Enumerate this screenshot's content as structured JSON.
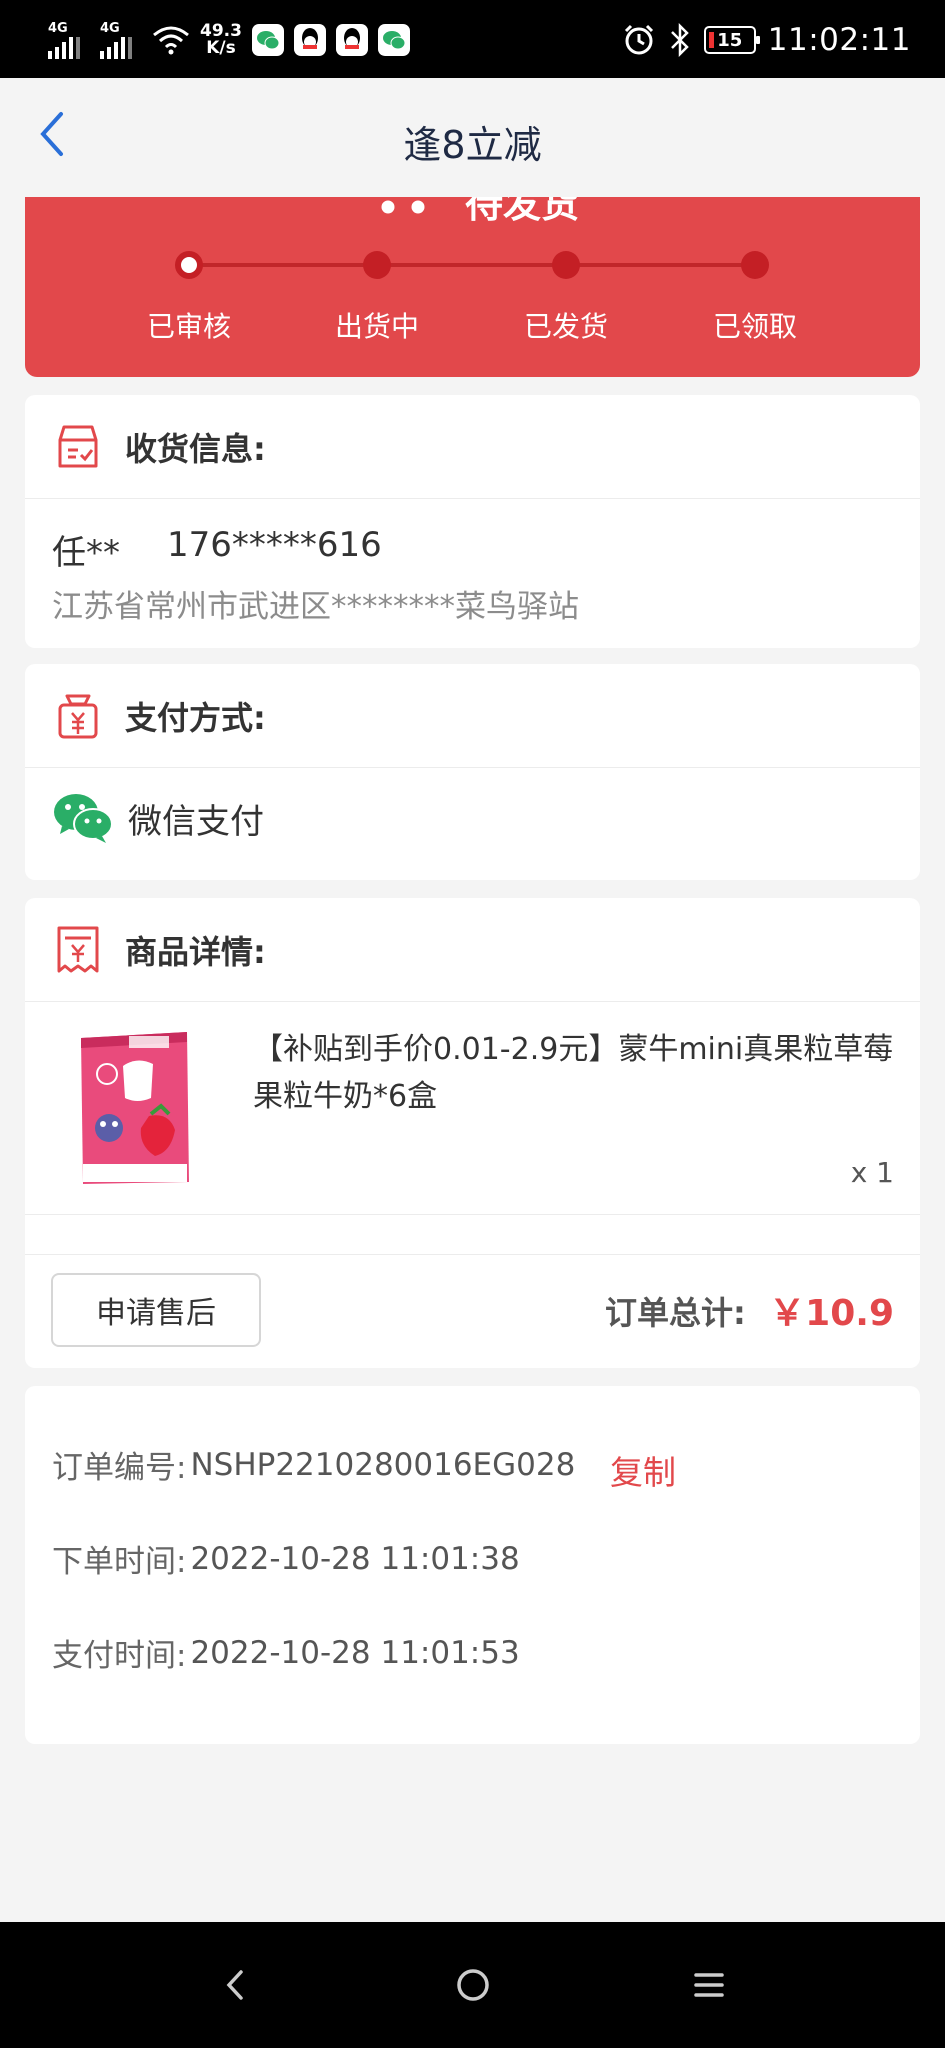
{
  "status_bar": {
    "signal1_label": "4G",
    "signal2_label": "4G",
    "net_speed_value": "49.3",
    "net_speed_unit": "K/s",
    "battery": "15",
    "time": "11:02:11"
  },
  "nav": {
    "title": "逢8立减",
    "back_icon": "chevron-left-icon"
  },
  "progress": {
    "status_text": "待发货",
    "steps": [
      {
        "label": "已审核",
        "active": true
      },
      {
        "label": "出货中",
        "active": false
      },
      {
        "label": "已发货",
        "active": false
      },
      {
        "label": "已领取",
        "active": false
      }
    ]
  },
  "shipping": {
    "title": "收货信息:",
    "name": "任**",
    "phone": "176*****616",
    "address": "江苏省常州市武进区********菜鸟驿站"
  },
  "payment": {
    "title": "支付方式:",
    "method": "微信支付"
  },
  "goods": {
    "title": "商品详情:",
    "item_title": "【补贴到手价0.01-2.9元】蒙牛mini真果粒草莓果粒牛奶*6盒",
    "quantity": "x 1",
    "after_sale_label": "申请售后",
    "total_label": "订单总计:",
    "total_value": "￥10.9"
  },
  "order_info": {
    "order_no_label": "订单编号:",
    "order_no": "NSHP2210280016EG028",
    "copy_label": "复制",
    "order_time_label": "下单时间:",
    "order_time": "2022-10-28 11:01:38",
    "pay_time_label": "支付时间:",
    "pay_time": "2022-10-28 11:01:53"
  },
  "colors": {
    "accent_red": "#e2484b",
    "nav_title": "#1f2a44",
    "back_blue": "#2a6fd8",
    "wechat_green": "#2aae67"
  }
}
